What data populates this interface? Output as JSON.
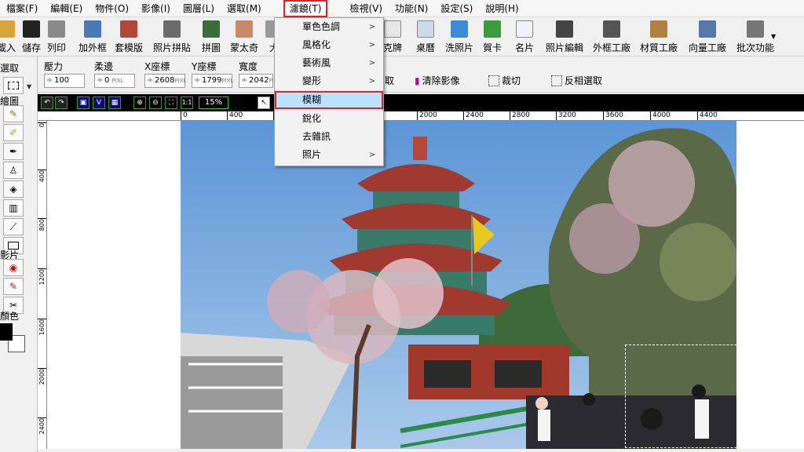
{
  "menubar": {
    "items": [
      "檔案(F)",
      "編輯(E)",
      "物件(O)",
      "影像(I)",
      "圖層(L)",
      "選取(M)",
      "濾鏡(T)",
      "檢視(V)",
      "功能(N)",
      "設定(S)",
      "說明(H)"
    ],
    "active_index": 6,
    "highlight_color": "#d9232a"
  },
  "toolbar": {
    "buttons": [
      "載入",
      "儲存",
      "列印",
      "加外框",
      "套模版",
      "照片拼貼",
      "拼圖",
      "蒙太奇",
      "大",
      "克牌",
      "桌曆",
      "洗照片",
      "賀卡",
      "名片",
      "照片編輯",
      "外框工廠",
      "材質工廠",
      "向量工廠",
      "批次功能"
    ]
  },
  "options": {
    "pressure": {
      "label": "壓力",
      "value": "100"
    },
    "softness": {
      "label": "柔邊",
      "value": "0",
      "unit": "PIXL"
    },
    "x": {
      "label": "X座標",
      "value": "2608",
      "unit": "PIXL"
    },
    "y": {
      "label": "Y座標",
      "value": "1799",
      "unit": "PIXL"
    },
    "width": {
      "label": "寬度",
      "value": "2042",
      "unit": "PIXL"
    },
    "commands": [
      "取",
      "清除影像",
      "裁切",
      "反相選取"
    ]
  },
  "leftpanel": {
    "labels": [
      "選取",
      "繪圖",
      "影片",
      "顏色"
    ]
  },
  "imagebar": {
    "zoom": "15%"
  },
  "ruler": {
    "h_ticks": [
      "0",
      "400",
      "",
      "",
      "",
      "",
      "2000",
      "2400",
      "2800",
      "3200",
      "3600",
      "4000",
      "4400"
    ],
    "v_ticks": [
      "0",
      "400",
      "800",
      "1200",
      "1600",
      "2000",
      "2400"
    ]
  },
  "dropdown": {
    "items": [
      {
        "label": "單色色調",
        "submenu": true
      },
      {
        "label": "風格化",
        "submenu": true
      },
      {
        "label": "藝術風",
        "submenu": true
      },
      {
        "label": "變形",
        "submenu": true
      },
      {
        "label": "模糊",
        "submenu": false
      },
      {
        "label": "銳化",
        "submenu": false
      },
      {
        "label": "去雜訊",
        "submenu": false
      },
      {
        "label": "照片",
        "submenu": true
      }
    ],
    "highlight_index": 4,
    "highlight_bg": "#bde2ff"
  }
}
